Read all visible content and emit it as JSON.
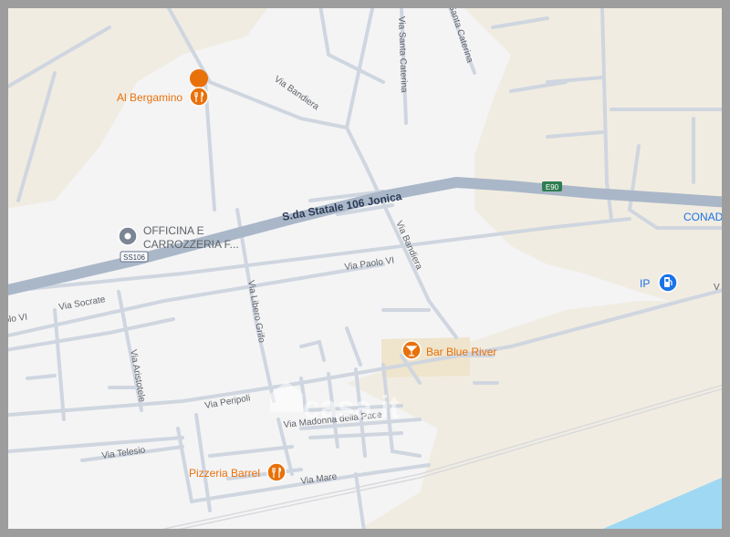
{
  "map": {
    "colors": {
      "land": "#f4f4f5",
      "sand": "#f1ece1",
      "road": "#cfd6e0",
      "highway": "#aab7c8",
      "water": "#9fd8f2",
      "poi_orange": "#e8710a",
      "poi_blue": "#1a73e8"
    },
    "highway_label": "S.da Statale 106 Jonica",
    "shields": {
      "ss106": "SS106",
      "e90": "E90"
    },
    "streets": {
      "via_bandiera_top": "Via Bandiera",
      "via_santa_caterina_1": "Via Santa Caterina",
      "via_santa_caterina_2": "Santa Caterina",
      "via_bandiera_mid": "Via Bandiera",
      "via_paolo_vi": "Via Paolo VI",
      "via_paolo_vi_left": "olo VI",
      "via_socrate": "Via Socrate",
      "via_libero_grifo": "Via Libero Grifo",
      "via_aristotele": "Via Aristotele",
      "via_peripoli": "Via Peripoli",
      "via_madonna_della_pace": "Via Madonna della Pace",
      "via_telesio": "Via Telesio",
      "via_mare": "Via Mare",
      "right_edge": "V"
    },
    "pois": {
      "al_bergamino": "Al Bergamino",
      "officina_line1": "OFFICINA E",
      "officina_line2": "CARROZZERIA F...",
      "bar_blue_river": "Bar Blue River",
      "pizzeria_barrel": "Pizzeria Barrel",
      "ip": "IP",
      "conad": "CONAD"
    },
    "watermark": "casa.it",
    "icons": {
      "restaurant": "restaurant-icon",
      "bar": "bar-icon",
      "place": "place-icon",
      "fuel": "fuel-icon"
    }
  }
}
